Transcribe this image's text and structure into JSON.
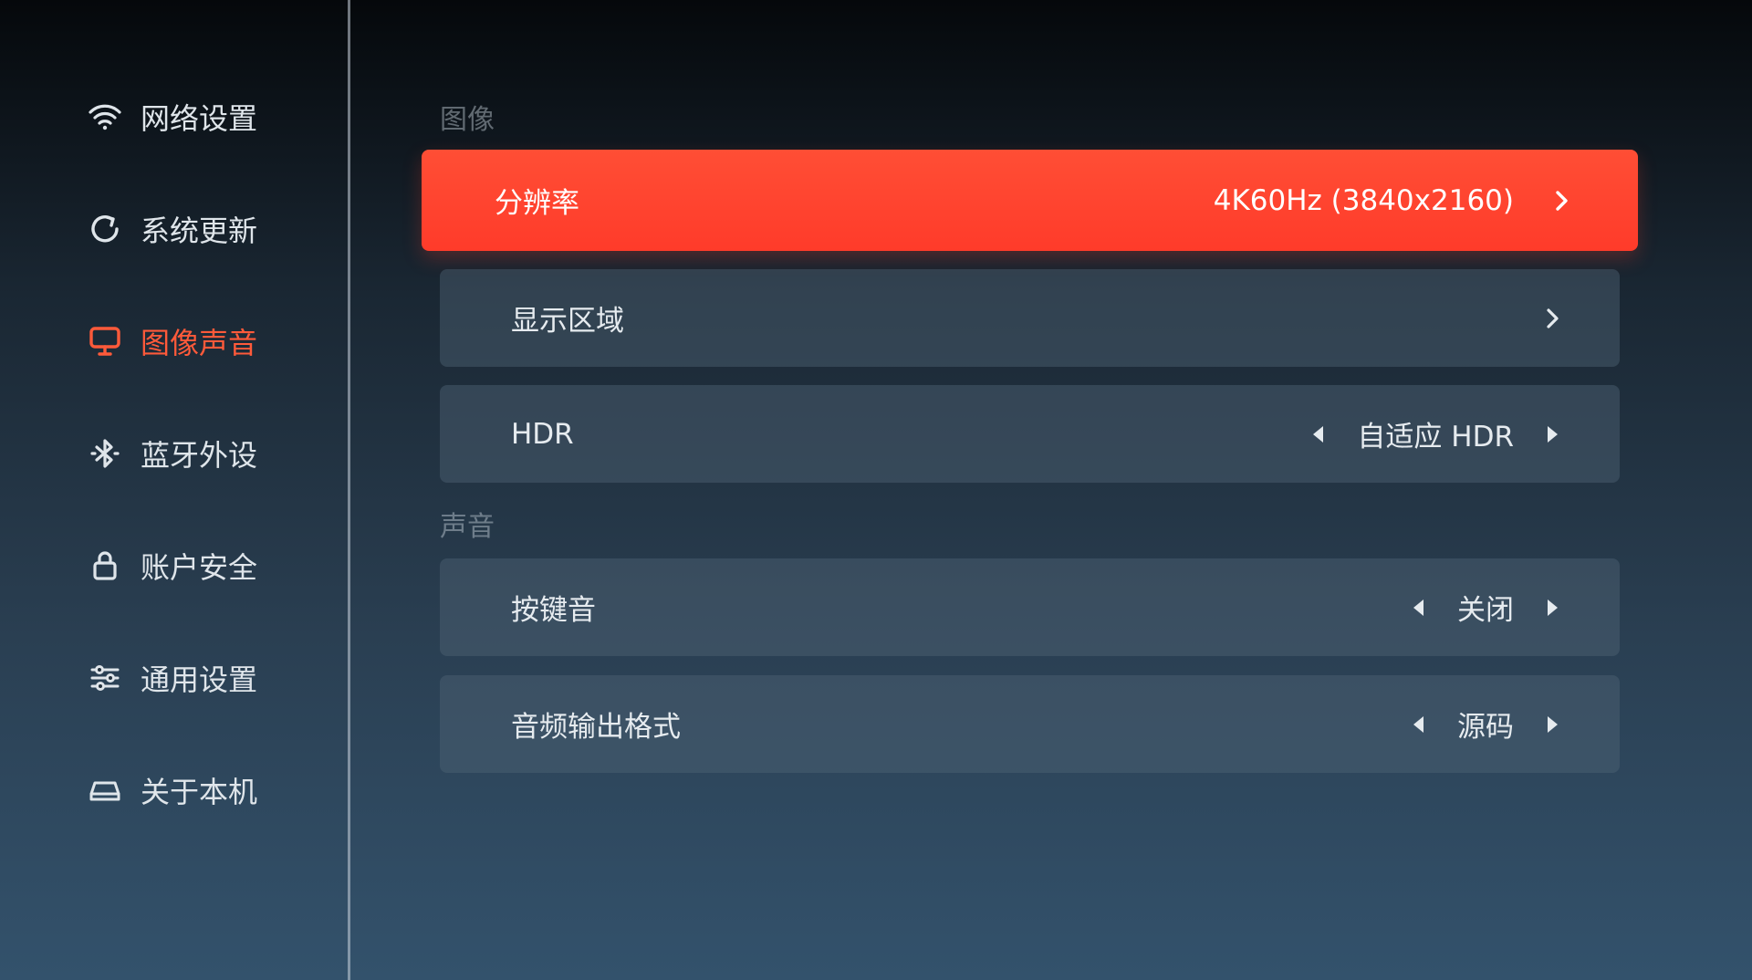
{
  "sidebar": {
    "items": [
      {
        "label": "网络设置",
        "icon": "wifi-icon"
      },
      {
        "label": "系统更新",
        "icon": "refresh-icon"
      },
      {
        "label": "图像声音",
        "icon": "monitor-icon",
        "active": true
      },
      {
        "label": "蓝牙外设",
        "icon": "bluetooth-icon"
      },
      {
        "label": "账户安全",
        "icon": "lock-icon"
      },
      {
        "label": "通用设置",
        "icon": "sliders-icon"
      },
      {
        "label": "关于本机",
        "icon": "device-icon"
      }
    ]
  },
  "image_section": {
    "title": "图像",
    "rows": [
      {
        "label": "分辨率",
        "value": "4K60Hz (3840x2160)"
      },
      {
        "label": "显示区域",
        "value": ""
      },
      {
        "label": "HDR",
        "value": "自适应 HDR"
      }
    ]
  },
  "sound_section": {
    "title": "声音",
    "rows": [
      {
        "label": "按键音",
        "value": "关闭"
      },
      {
        "label": "音频输出格式",
        "value": "源码"
      }
    ]
  },
  "colors": {
    "accent": "#ff4a32",
    "active_text": "#ff5a3a"
  }
}
